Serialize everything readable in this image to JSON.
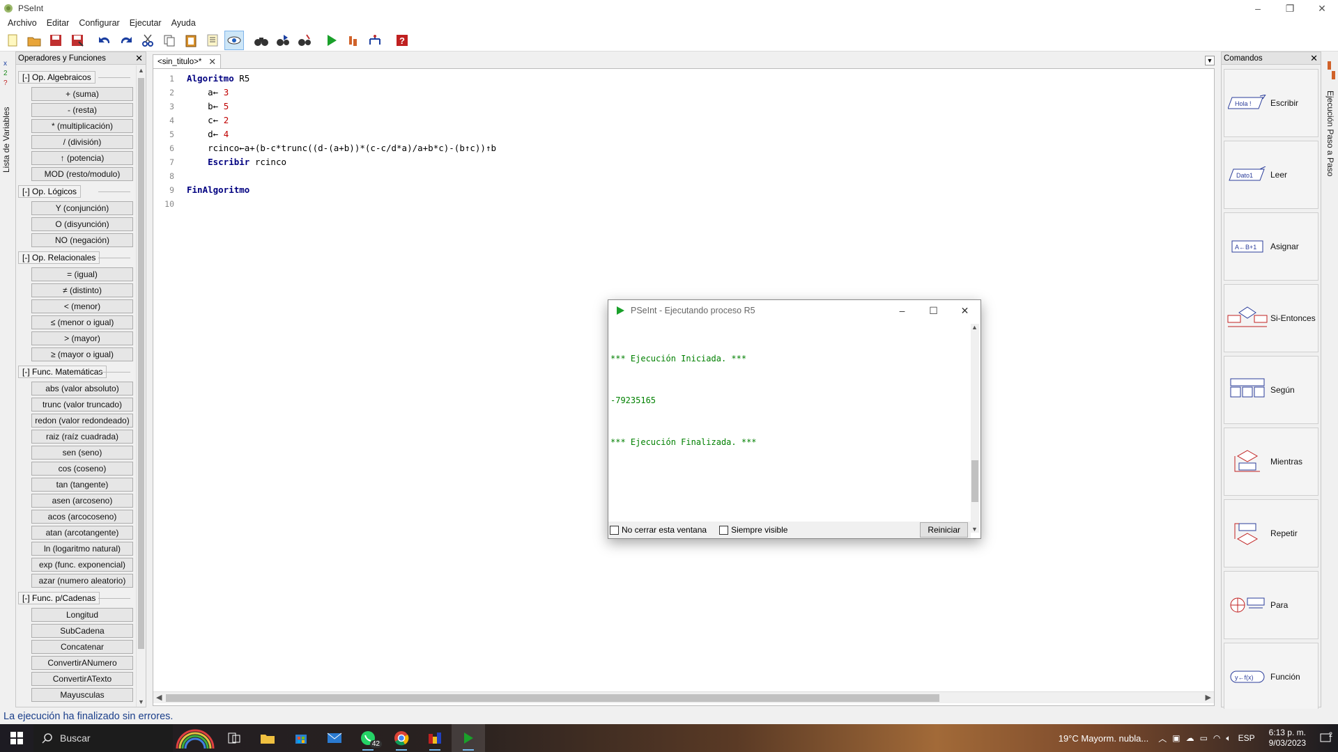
{
  "window": {
    "title": "PSeInt",
    "min": "–",
    "restore": "❐",
    "close": "✕"
  },
  "menu": [
    "Archivo",
    "Editar",
    "Configurar",
    "Ejecutar",
    "Ayuda"
  ],
  "left_vtab": "Lista de Variables",
  "left_panel": {
    "title": "Operadores y Funciones",
    "close": "✕",
    "groups": [
      {
        "label": "[-]  Op. Algebraicos",
        "items": [
          "+ (suma)",
          "- (resta)",
          "* (multiplicación)",
          "/ (división)",
          "↑ (potencia)",
          "MOD (resto/modulo)"
        ]
      },
      {
        "label": "[-]  Op. Lógicos",
        "items": [
          "Y (conjunción)",
          "O (disyunción)",
          "NO (negación)"
        ]
      },
      {
        "label": "[-]  Op. Relacionales",
        "items": [
          "= (igual)",
          "≠ (distinto)",
          "< (menor)",
          "≤ (menor o igual)",
          "> (mayor)",
          "≥ (mayor o igual)"
        ]
      },
      {
        "label": "[-]  Func. Matemáticas",
        "items": [
          "abs (valor absoluto)",
          "trunc (valor truncado)",
          "redon (valor redondeado)",
          "raiz (raíz cuadrada)",
          "sen (seno)",
          "cos (coseno)",
          "tan (tangente)",
          "asen (arcoseno)",
          "acos (arcocoseno)",
          "atan (arcotangente)",
          "ln (logaritmo natural)",
          "exp (func. exponencial)",
          "azar (numero aleatorio)"
        ]
      },
      {
        "label": "[-]  Func. p/Cadenas",
        "items": [
          "Longitud",
          "SubCadena",
          "Concatenar",
          "ConvertirANumero",
          "ConvertirATexto",
          "Mayusculas"
        ]
      }
    ]
  },
  "editor": {
    "tab_label": "<sin_titulo>*",
    "tab_close": "✕",
    "lines": [
      "1",
      "2",
      "3",
      "4",
      "5",
      "6",
      "7",
      "8",
      "9",
      "10"
    ],
    "code": [
      [
        {
          "t": "Algoritmo",
          "c": "kw"
        },
        {
          "t": " R5",
          "c": ""
        }
      ],
      [
        {
          "t": "    a← ",
          "c": ""
        },
        {
          "t": "3",
          "c": "num"
        }
      ],
      [
        {
          "t": "    b← ",
          "c": ""
        },
        {
          "t": "5",
          "c": "num"
        }
      ],
      [
        {
          "t": "    c← ",
          "c": ""
        },
        {
          "t": "2",
          "c": "num"
        }
      ],
      [
        {
          "t": "    d← ",
          "c": ""
        },
        {
          "t": "4",
          "c": "num"
        }
      ],
      [
        {
          "t": "    rcinco←a+(b-c*trunc((d-(a+b))*(c-c/d*a)/a+b*c)-(b↑c))↑b",
          "c": ""
        }
      ],
      [
        {
          "t": "    ",
          "c": ""
        },
        {
          "t": "Escribir",
          "c": "kw"
        },
        {
          "t": " rcinco",
          "c": ""
        }
      ],
      [
        {
          "t": "",
          "c": ""
        }
      ],
      [
        {
          "t": "FinAlgoritmo",
          "c": "kw"
        }
      ],
      [
        {
          "t": "",
          "c": ""
        }
      ]
    ]
  },
  "right_panel": {
    "title": "Comandos",
    "close": "✕",
    "commands": [
      "Escribir",
      "Leer",
      "Asignar",
      "Si-Entonces",
      "Según",
      "Mientras",
      "Repetir",
      "Para",
      "Función"
    ]
  },
  "right_vtab": "Ejecución Paso a Paso",
  "status": "La ejecución ha finalizado sin errores.",
  "console": {
    "title": "PSeInt - Ejecutando proceso R5",
    "lines": [
      "*** Ejecución Iniciada. ***",
      "-79235165",
      "*** Ejecución Finalizada. ***"
    ],
    "no_cerrar": "No cerrar esta ventana",
    "siempre_visible": "Siempre visible",
    "reiniciar": "Reiniciar"
  },
  "taskbar": {
    "search": "Buscar",
    "weather": "19°C  Mayorm. nubla...",
    "lang": "ESP",
    "time": "6:13 p. m.",
    "date": "9/03/2023",
    "whatsapp_badge": "42",
    "notif_count": "2"
  }
}
